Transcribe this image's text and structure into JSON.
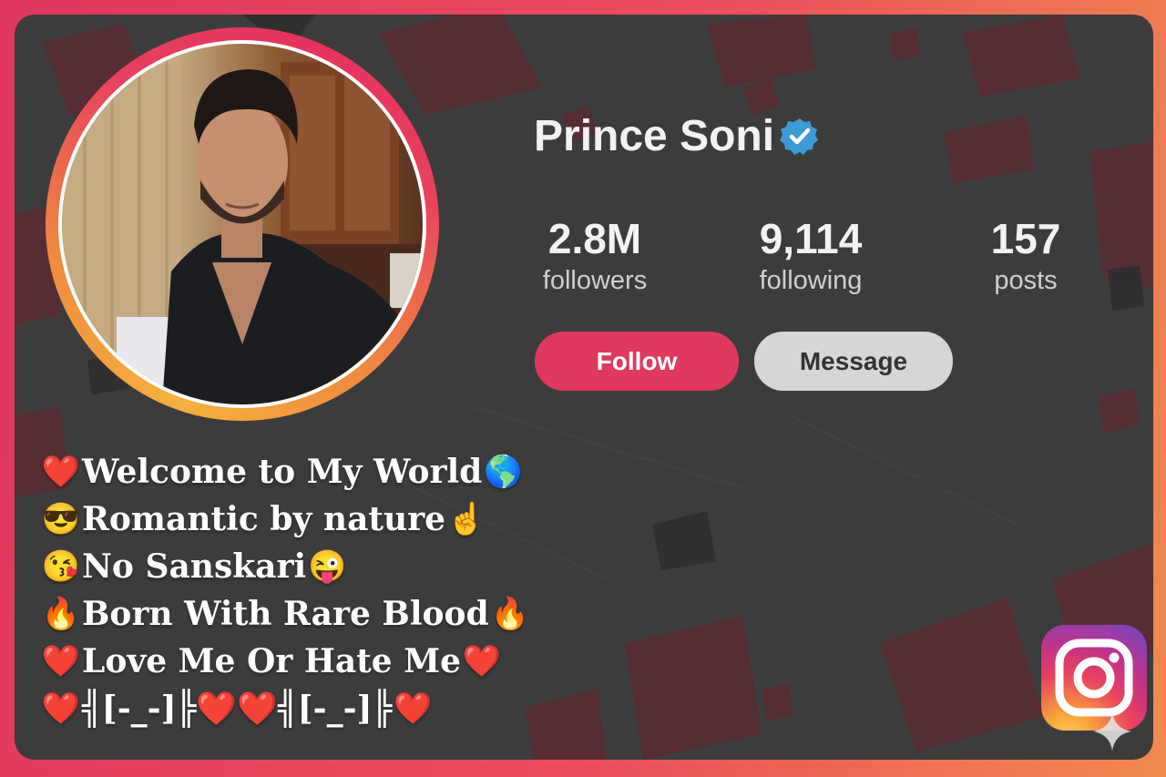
{
  "profile": {
    "name": "Prince Soni",
    "verified": true,
    "avatar": "profile-photo"
  },
  "stats": {
    "followers": {
      "value": "2.8M",
      "label": "followers"
    },
    "following": {
      "value": "9,114",
      "label": "following"
    },
    "posts": {
      "value": "157",
      "label": "posts"
    }
  },
  "actions": {
    "follow_label": "Follow",
    "message_label": "Message"
  },
  "bio": [
    {
      "lead": "❤️",
      "text": "Welcome to My World ",
      "trail": "🌎"
    },
    {
      "lead": "😎",
      "text": " Romantic by nature ",
      "trail": "☝️"
    },
    {
      "lead": "😘",
      "text": "No Sanskari ",
      "trail": "😜"
    },
    {
      "lead": "🔥",
      "text": "Born With Rare Blood ",
      "trail": "🔥"
    },
    {
      "lead": "❤️",
      "text": "Love Me Or Hate Me",
      "trail": "❤️"
    },
    {
      "lead": "❤️",
      "text": "╣[-_-]╠❤️❤️╣[-_-]╠",
      "trail": "❤️"
    }
  ],
  "colors": {
    "accent": "#e0385f",
    "card_background": "#3c3c3c",
    "message_button": "#d6d6d6",
    "verified_badge": "#3d9bd6"
  },
  "icons": {
    "verified": "verified-badge-icon",
    "brand": "instagram-logo-icon",
    "corner": "sparkle-icon"
  }
}
